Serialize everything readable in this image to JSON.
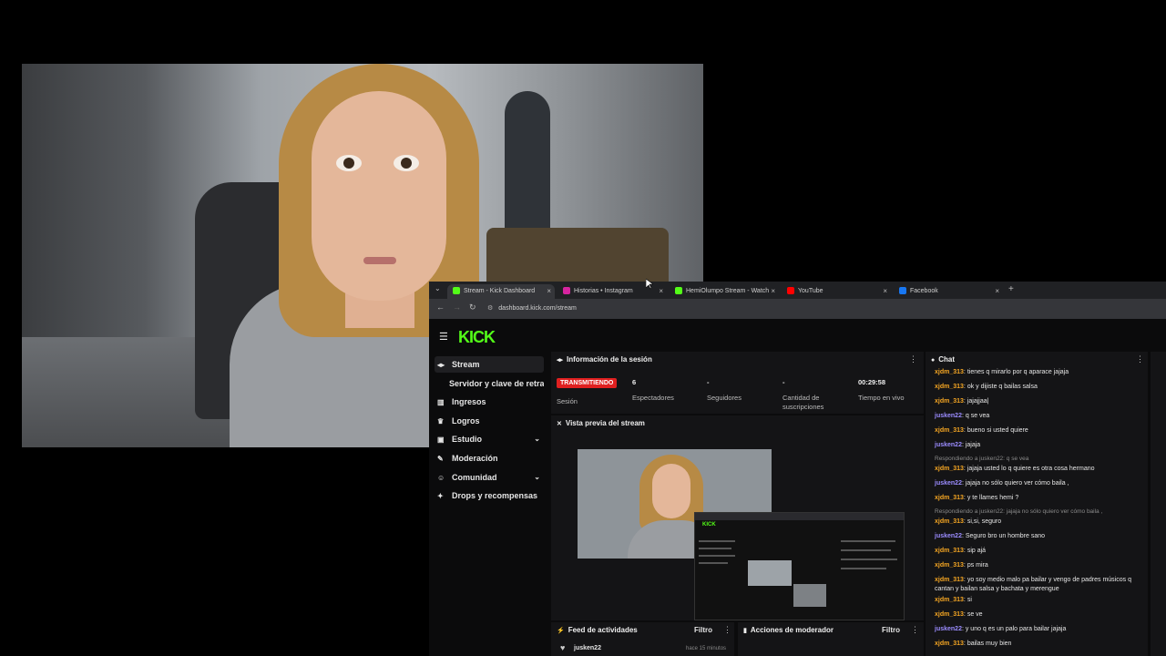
{
  "browser": {
    "tabs": [
      {
        "title": "Stream - Kick Dashboard",
        "favicon": "kick-icon",
        "color": "#53fc18",
        "active": true
      },
      {
        "title": "Historias • Instagram",
        "favicon": "instagram-icon",
        "color": "#d6249f",
        "active": false
      },
      {
        "title": "HemiOlumpo Stream - Watch",
        "favicon": "kick-icon",
        "color": "#53fc18",
        "active": false
      },
      {
        "title": "YouTube",
        "favicon": "youtube-icon",
        "color": "#ff0000",
        "active": false
      },
      {
        "title": "Facebook",
        "favicon": "facebook-icon",
        "color": "#1877f2",
        "active": false
      }
    ],
    "url": "dashboard.kick.com/stream"
  },
  "kick": {
    "logo": "KICK",
    "accent": "#53fc18",
    "sidebar": [
      {
        "label": "Stream",
        "icon": "stream-icon",
        "active": true
      },
      {
        "label": "Servidor y clave de retransmisión",
        "icon": "",
        "active": false
      },
      {
        "label": "Ingresos",
        "icon": "chart-icon",
        "active": false
      },
      {
        "label": "Logros",
        "icon": "trophy-icon",
        "active": false
      },
      {
        "label": "Estudio",
        "icon": "studio-icon",
        "active": false,
        "chevron": true
      },
      {
        "label": "Moderación",
        "icon": "wrench-icon",
        "active": false
      },
      {
        "label": "Comunidad",
        "icon": "community-icon",
        "active": false,
        "chevron": true
      },
      {
        "label": "Drops y recompensas",
        "icon": "gift-icon",
        "active": false
      }
    ],
    "session": {
      "title": "Información de la sesión",
      "status": "TRANSMITIENDO",
      "status_label": "Sesión",
      "viewers_value": "6",
      "viewers_label": "Espectadores",
      "followers_value": "-",
      "followers_label": "Seguidores",
      "subs_value": "-",
      "subs_label": "Cantidad de suscripciones",
      "uptime_value": "00:29:58",
      "uptime_label": "Tiempo en vivo"
    },
    "preview": {
      "title": "Vista previa del stream"
    },
    "activity": {
      "title": "Feed de actividades",
      "filter": "Filtro",
      "first_user": "jusken22",
      "first_time": "hace 15 minutos"
    },
    "mod": {
      "title": "Acciones de moderador",
      "filter": "Filtro"
    },
    "chat": {
      "title": "Chat",
      "messages": [
        {
          "user": "xjdm_313",
          "color": "#f5a623",
          "text": "tienes q mirarlo por q aparace jajaja"
        },
        {
          "user": "xjdm_313",
          "color": "#f5a623",
          "text": "ok y dijiste q bailas salsa"
        },
        {
          "user": "xjdm_313",
          "color": "#f5a623",
          "text": "jajajjaa|"
        },
        {
          "user": "jusken22",
          "color": "#9b8cff",
          "text": "q se vea"
        },
        {
          "user": "xjdm_313",
          "color": "#f5a623",
          "text": "bueno si usted quiere"
        },
        {
          "user": "jusken22",
          "color": "#9b8cff",
          "text": "jajaja"
        },
        {
          "reply": "Respondiendo a jusken22: q se vea"
        },
        {
          "user": "xjdm_313",
          "color": "#f5a623",
          "text": "jajaja usted lo q quiere es otra cosa hermano"
        },
        {
          "user": "jusken22",
          "color": "#9b8cff",
          "text": "jajaja no sólo quiero ver cómo baila ,"
        },
        {
          "user": "xjdm_313",
          "color": "#f5a623",
          "text": "y te llames hemi ?"
        },
        {
          "reply": "Respondiendo a jusken22: jajaja no sólo quiero ver cómo baila ,"
        },
        {
          "user": "xjdm_313",
          "color": "#f5a623",
          "text": "si,si, seguro"
        },
        {
          "user": "jusken22",
          "color": "#9b8cff",
          "text": "Seguro bro  un hombre sano"
        },
        {
          "user": "xjdm_313",
          "color": "#f5a623",
          "text": "sip ajá"
        },
        {
          "user": "xjdm_313",
          "color": "#f5a623",
          "text": "ps mira"
        },
        {
          "user": "xjdm_313",
          "color": "#f5a623",
          "text": "yo soy medio malo pa bailar y vengo de padres músicos q cantan y bailan salsa y bachata y merengue"
        },
        {
          "user": "xjdm_313",
          "color": "#f5a623",
          "text": "si"
        },
        {
          "user": "xjdm_313",
          "color": "#f5a623",
          "text": "se ve"
        },
        {
          "user": "jusken22",
          "color": "#9b8cff",
          "text": "y uno q es un palo para bailar jajaja"
        },
        {
          "user": "xjdm_313",
          "color": "#f5a623",
          "text": "bailas muy bien"
        }
      ]
    }
  }
}
